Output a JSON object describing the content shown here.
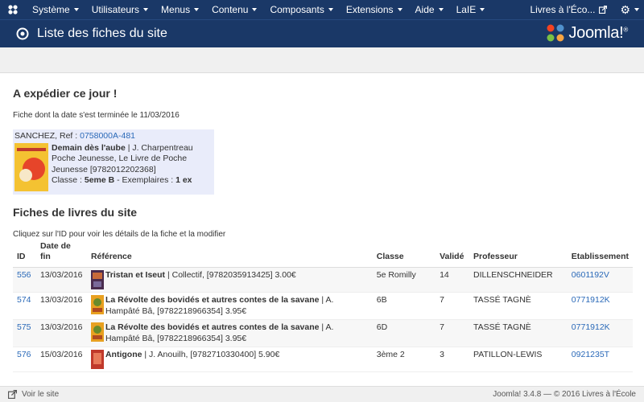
{
  "nav": {
    "items": [
      {
        "label": "Système"
      },
      {
        "label": "Utilisateurs"
      },
      {
        "label": "Menus"
      },
      {
        "label": "Contenu"
      },
      {
        "label": "Composants"
      },
      {
        "label": "Extensions"
      },
      {
        "label": "Aide"
      },
      {
        "label": "LaIE"
      }
    ],
    "site_link": "Livres à l'Éco...",
    "icons": {
      "logo": "joomla-icon",
      "external": "external-link-icon",
      "settings": "gear-icon"
    }
  },
  "header": {
    "title": "Liste des fiches du site",
    "brand": "Joomla!",
    "brand_mark": "®"
  },
  "ship_today": {
    "heading": "A expédier ce jour !",
    "subtitle": "Fiche dont la date s'est terminée le 11/03/2016",
    "card": {
      "owner": "SANCHEZ, Ref :",
      "ref": "0758000A-481",
      "book_title": "Demain dès l'aube",
      "book_rest": " | J. Charpentreau Poche Jeunesse, Le Livre de Poche Jeunesse [9782012202368]",
      "class_label": "Classe : ",
      "class_value": "5eme B",
      "copies_label": " - Exemplaires : ",
      "copies_value": "1 ex"
    }
  },
  "list": {
    "heading": "Fiches de livres du site",
    "subtitle": "Cliquez sur l'ID pour voir les détails de la fiche et la modifier",
    "columns": {
      "id": "ID",
      "date_line1": "Date de",
      "date_line2": "fin",
      "ref": "Référence",
      "classe": "Classe",
      "valide": "Validé",
      "prof": "Professeur",
      "etab": "Etablissement"
    },
    "rows": [
      {
        "id": "556",
        "date": "13/03/2016",
        "title": "Tristan et Iseut",
        "rest": " | Collectif, [9782035913425] 3.00€",
        "classe": "5e Romilly",
        "valide": "14",
        "prof": "DILLENSCHNEIDER",
        "etab": "0601192V"
      },
      {
        "id": "574",
        "date": "13/03/2016",
        "title": "La Révolte des bovidés et autres contes de la savane",
        "rest": " | A. Hampâté Bâ, [9782218966354] 3.95€",
        "classe": "6B",
        "valide": "7",
        "prof": "TASSÉ TAGNÈ",
        "etab": "0771912K"
      },
      {
        "id": "575",
        "date": "13/03/2016",
        "title": "La Révolte des bovidés et autres contes de la savane",
        "rest": " | A. Hampâté Bâ, [9782218966354] 3.95€",
        "classe": "6D",
        "valide": "7",
        "prof": "TASSÉ TAGNÈ",
        "etab": "0771912K"
      },
      {
        "id": "576",
        "date": "15/03/2016",
        "title": "Antigone",
        "rest": " | J. Anouilh, [9782710330400] 5.90€",
        "classe": "3ème 2",
        "valide": "3",
        "prof": "PATILLON-LEWIS",
        "etab": "0921235T"
      }
    ]
  },
  "status": {
    "view_site": "Voir le site",
    "footer": "Joomla! 3.4.8  —  © 2016 Livres à l'École"
  },
  "colors": {
    "nav_bg": "#1a3867",
    "link": "#2a69b8",
    "card_bg": "#e9ecfa"
  }
}
